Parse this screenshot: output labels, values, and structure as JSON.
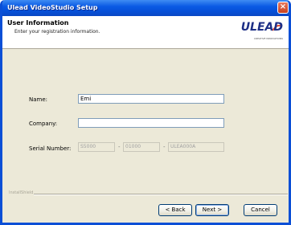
{
  "window": {
    "title": "Ulead VideoStudio Setup",
    "close_glyph": "×"
  },
  "header": {
    "title": "User Information",
    "subtitle": "Enter your registration information.",
    "logo_text": "ULEAD",
    "logo_tagline": "CREATIVE INNOVATIONS",
    "logo_color": "#1d2f86",
    "logo_accent_color": "#e03a1e"
  },
  "form": {
    "name_label": "Name:",
    "name_value": "Emi",
    "company_label": "Company:",
    "company_value": "",
    "serial_label": "Serial Number:",
    "serial_parts": [
      "S5000",
      "01000",
      "ULEA000A"
    ],
    "serial_separator": "-"
  },
  "footer": {
    "brand": "InstallShield"
  },
  "buttons": {
    "back": "< Back",
    "next": "Next >",
    "cancel": "Cancel"
  },
  "colors": {
    "titlebar": "#0a5ae4",
    "dialog_face": "#ece9d8"
  }
}
